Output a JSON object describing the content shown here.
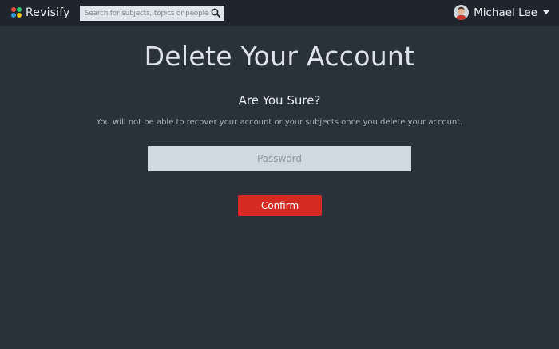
{
  "app": {
    "name": "Revisify",
    "logo_colors": [
      "#e84c3d",
      "#2ecc71",
      "#3498db",
      "#f1c40f"
    ]
  },
  "search": {
    "placeholder": "Search for subjects, topics or people",
    "icon": "search-icon"
  },
  "user": {
    "name": "Michael Lee",
    "avatar": "user-avatar",
    "menu_icon": "caret-down-icon"
  },
  "main": {
    "title": "Delete Your Account",
    "subtitle": "Are You Sure?",
    "warning": "You will not be able to recover your account or your subjects once you delete your account.",
    "password_placeholder": "Password",
    "confirm_label": "Confirm"
  },
  "colors": {
    "background": "#29313a",
    "navbar": "#1f252c",
    "danger": "#d52a22",
    "input_bg": "#d0d9df"
  }
}
